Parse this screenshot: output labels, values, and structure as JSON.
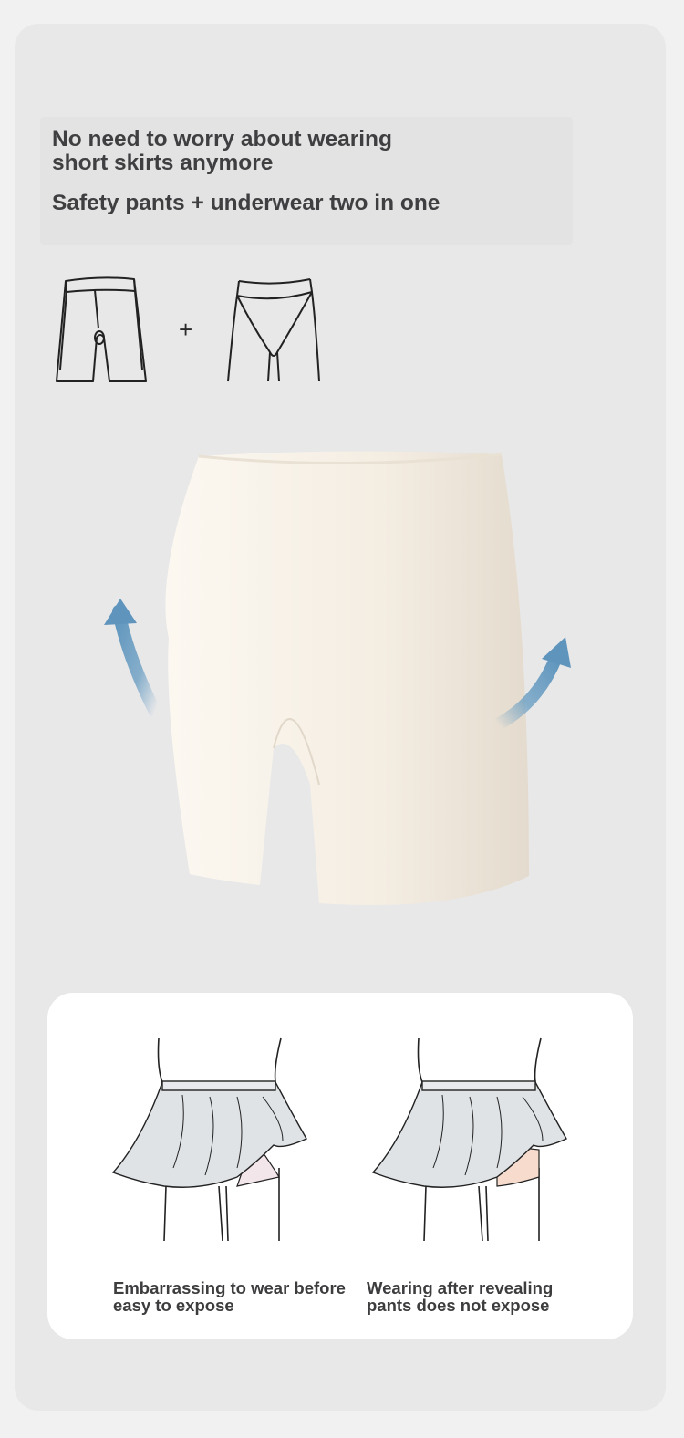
{
  "headline": {
    "line1": "No need to worry about wearing\n short skirts anymore",
    "line2": "Safety pants + underwear two in one"
  },
  "icons": {
    "plus": "+",
    "shorts": "boxer-shorts-icon",
    "briefs": "briefs-icon",
    "arrows": "curved-up-arrow-icon"
  },
  "comparison": {
    "before_caption": "Embarrassing to wear before\n easy to expose",
    "after_caption": "Wearing after revealing\npants does not expose"
  },
  "colors": {
    "background": "#e8e8e9",
    "text": "#3f3f41",
    "fabric": "#f3ece2",
    "arrow": "#6c9fc3",
    "skirt": "#dfe3e6",
    "safety_pants": "#f7dccd"
  }
}
